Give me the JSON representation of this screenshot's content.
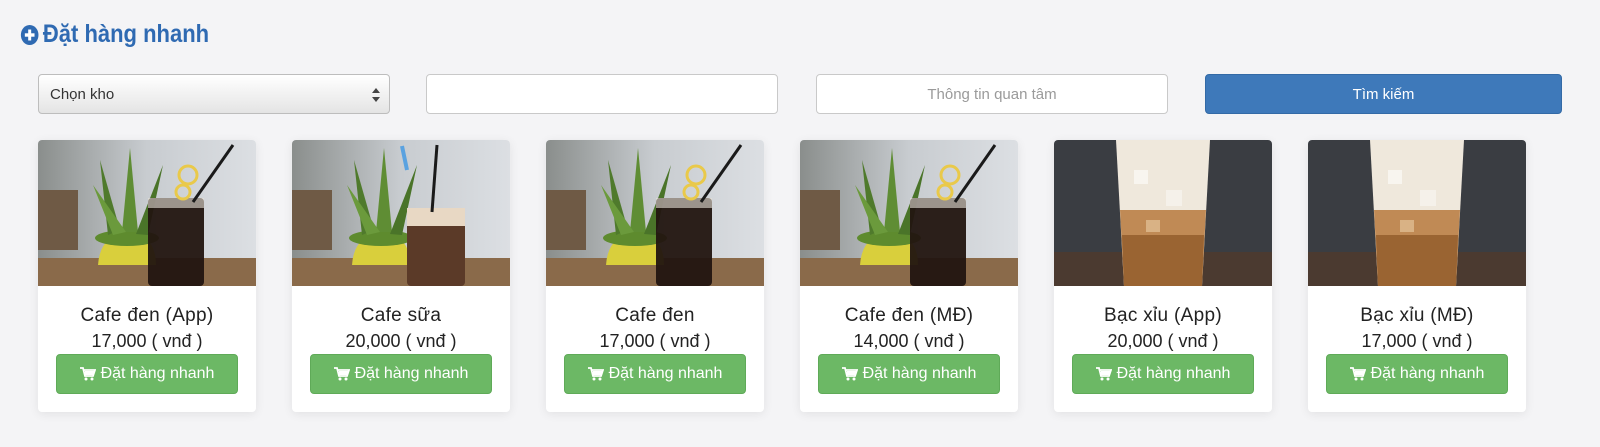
{
  "header": {
    "title": "Đặt hàng nhanh",
    "icon": "plus-circle-icon",
    "color": "#2f6ab2"
  },
  "filters": {
    "warehouse_select": {
      "selected": "Chọn kho"
    },
    "keyword_input": {
      "value": "",
      "placeholder": ""
    },
    "interest_input": {
      "value": "",
      "placeholder": "Thông tin quan tâm"
    },
    "search_label": "Tìm kiếm",
    "search_color": "#3e79ba"
  },
  "products": [
    {
      "name": "Cafe đen (App)",
      "price": "17,000 ( vnđ )",
      "button": "Đặt hàng nhanh",
      "image": "black-coffee-plant-photo"
    },
    {
      "name": "Cafe sữa",
      "price": "20,000 ( vnđ )",
      "button": "Đặt hàng nhanh",
      "image": "milk-coffee-plant-photo"
    },
    {
      "name": "Cafe đen",
      "price": "17,000 ( vnđ )",
      "button": "Đặt hàng nhanh",
      "image": "black-coffee-plant-photo"
    },
    {
      "name": "Cafe đen (MĐ)",
      "price": "14,000 ( vnđ )",
      "button": "Đặt hàng nhanh",
      "image": "black-coffee-plant-photo"
    },
    {
      "name": "Bạc xỉu (App)",
      "price": "20,000 ( vnđ )",
      "button": "Đặt hàng nhanh",
      "image": "bac-xiu-glass-photo"
    },
    {
      "name": "Bạc xỉu (MĐ)",
      "price": "17,000 ( vnđ )",
      "button": "Đặt hàng nhanh",
      "image": "bac-xiu-glass-photo"
    }
  ],
  "order_button_color": "#6cb865"
}
